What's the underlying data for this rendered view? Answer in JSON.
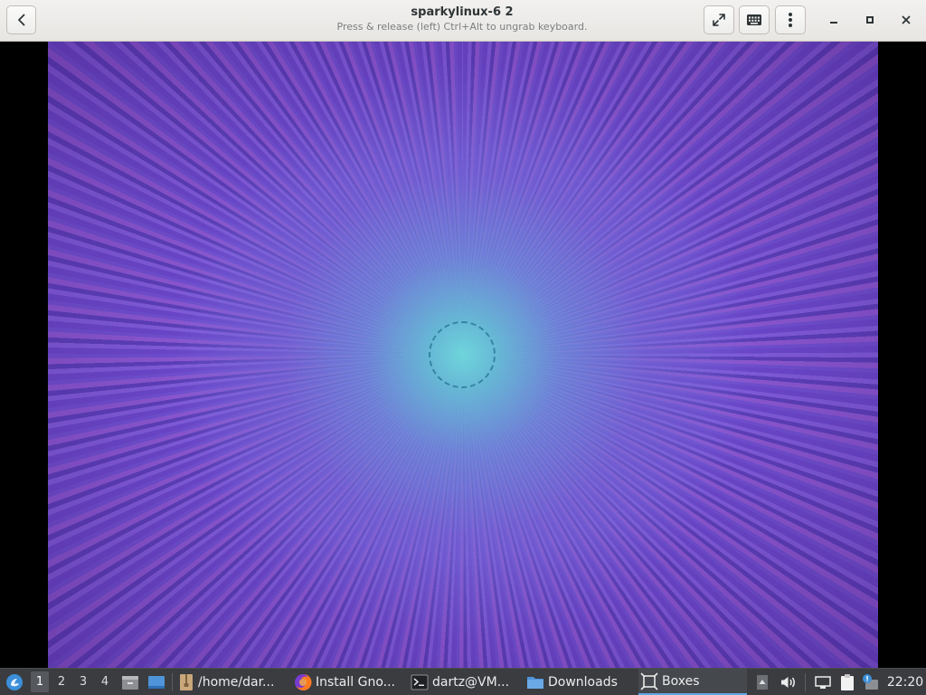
{
  "window": {
    "title": "sparkylinux-6 2",
    "subtitle": "Press & release (left) Ctrl+Alt to ungrab keyboard."
  },
  "header_buttons": {
    "back": "back-icon",
    "fullscreen": "fullscreen-icon",
    "keyboard": "keyboard-icon",
    "menu": "vertical-dots-icon",
    "minimize": "minimize-icon",
    "maximize": "maximize-icon",
    "close": "close-icon"
  },
  "taskbar": {
    "workspaces": [
      "1",
      "2",
      "3",
      "4"
    ],
    "active_workspace": "1",
    "tasks": [
      {
        "label": "/home/dar...",
        "icon": "archive-icon"
      },
      {
        "label": "Install Gno...",
        "icon": "firefox-icon"
      },
      {
        "label": "dartz@VM...",
        "icon": "terminal-icon"
      },
      {
        "label": "Downloads",
        "icon": "folder-icon"
      },
      {
        "label": "Boxes",
        "icon": "boxes-icon"
      }
    ],
    "active_task": "Boxes",
    "clock": "22:20"
  },
  "colors": {
    "headerbar": "#eae8e5",
    "taskbar": "#3a3c40",
    "wallpaper_primary": "#6a4bc8",
    "wallpaper_center": "#6edcdc",
    "active_task_accent": "#5ea8e8"
  }
}
